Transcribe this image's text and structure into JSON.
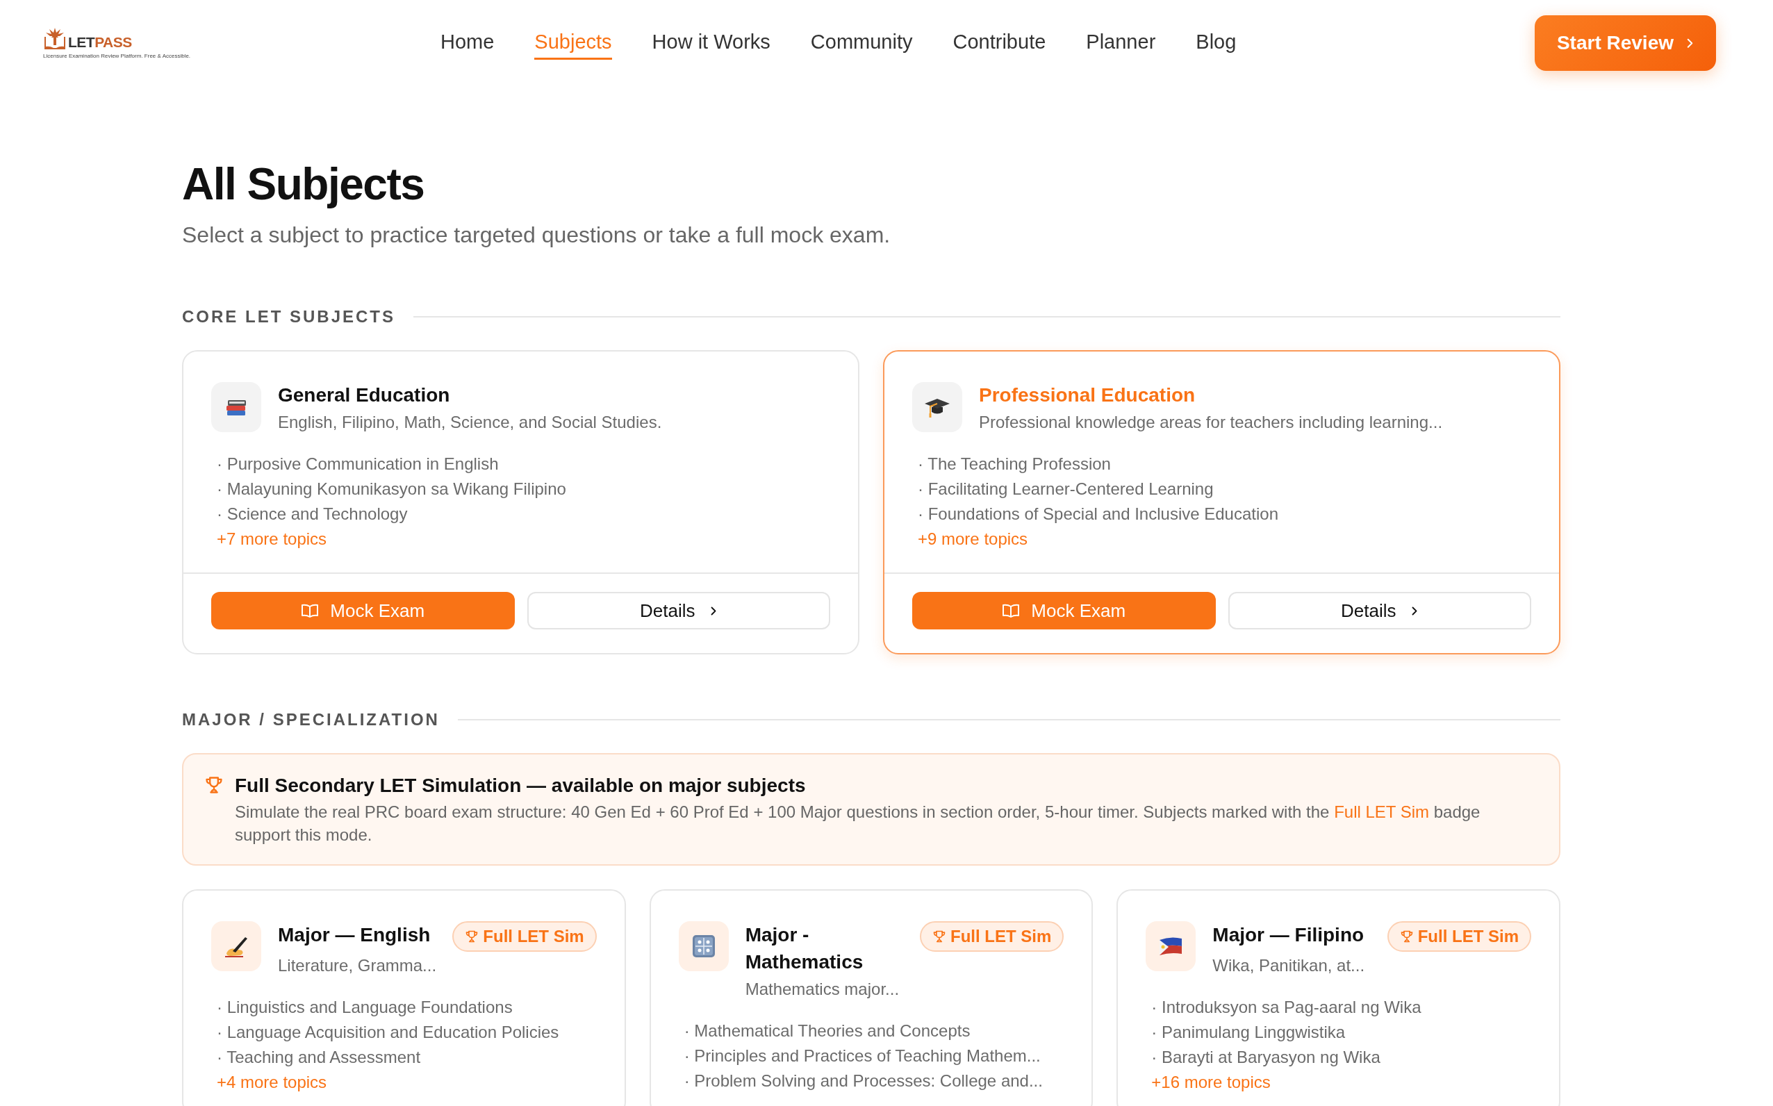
{
  "header": {
    "logo": {
      "name_parts": [
        "LET",
        "PASS"
      ],
      "tagline": "Licensure Examination Review Platform. Free & Accessible."
    },
    "nav": [
      {
        "label": "Home",
        "selected": false
      },
      {
        "label": "Subjects",
        "selected": true
      },
      {
        "label": "How it Works",
        "selected": false
      },
      {
        "label": "Community",
        "selected": false
      },
      {
        "label": "Contribute",
        "selected": false
      },
      {
        "label": "Planner",
        "selected": false
      },
      {
        "label": "Blog",
        "selected": false
      }
    ],
    "cta": "Start Review"
  },
  "page": {
    "title": "All Subjects",
    "subtitle": "Select a subject to practice targeted questions or take a full mock exam."
  },
  "core_section": {
    "heading": "CORE LET SUBJECTS",
    "cards": [
      {
        "title": "General Education",
        "description": "English, Filipino, Math, Science, and Social Studies.",
        "topics": [
          "· Purposive Communication in English",
          "· Malayuning Komunikasyon sa Wikang Filipino",
          "· Science and Technology"
        ],
        "more": "+7 more topics",
        "highlighted": false,
        "mock_button": "Mock Exam",
        "details_button": "Details"
      },
      {
        "title": "Professional Education",
        "description": "Professional knowledge areas for teachers including learning...",
        "topics": [
          "· The Teaching Profession",
          "· Facilitating Learner-Centered Learning",
          "· Foundations of Special and Inclusive Education"
        ],
        "more": "+9 more topics",
        "highlighted": true,
        "mock_button": "Mock Exam",
        "details_button": "Details"
      }
    ]
  },
  "major_section": {
    "heading": "MAJOR / SPECIALIZATION",
    "banner": {
      "title": "Full Secondary LET Simulation — available on major subjects",
      "text_before": "Simulate the real PRC board exam structure: 40 Gen Ed + 60 Prof Ed + 100 Major questions in section order, 5-hour timer. Subjects marked with the ",
      "link": "Full LET Sim",
      "text_after": " badge support this mode."
    },
    "cards": [
      {
        "title": "Major — English",
        "badge": "Full LET Sim",
        "description": "Literature, Gramma...",
        "topics": [
          "· Linguistics and Language Foundations",
          "· Language Acquisition and Education Policies",
          "· Teaching and Assessment"
        ],
        "more": "+4 more topics"
      },
      {
        "title": "Major - Mathematics",
        "badge": "Full LET Sim",
        "description": "Mathematics major...",
        "topics": [
          "· Mathematical Theories and Concepts",
          "· Principles and Practices of Teaching Mathem...",
          "· Problem Solving and Processes: College and..."
        ]
      },
      {
        "title": "Major — Filipino",
        "badge": "Full LET Sim",
        "description": "Wika, Panitikan, at...",
        "topics": [
          "· Introduksyon sa Pag-aaral ng Wika",
          "· Panimulang Linggwistika",
          "· Barayti at Baryasyon ng Wika"
        ],
        "more": "+16 more topics"
      }
    ]
  }
}
